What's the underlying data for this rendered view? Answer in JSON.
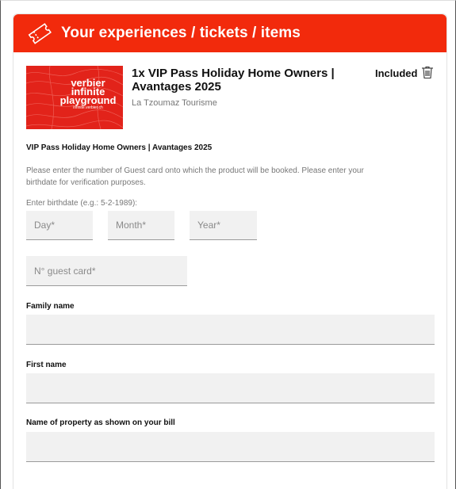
{
  "header": {
    "title": "Your experiences / tickets / items",
    "icon": "ticket-icon",
    "color": "#f22a0c"
  },
  "product": {
    "image_text": {
      "line1": "verbier",
      "line2": "infinite",
      "line3": "playground",
      "line4": "infinite.verbier.ch"
    },
    "title": "1x VIP Pass Holiday Home Owners | Avantages 2025",
    "vendor": "La Tzoumaz Tourisme",
    "status": "Included",
    "delete_icon": "trash-icon"
  },
  "form": {
    "section_title": "VIP Pass Holiday Home Owners | Avantages 2025",
    "help_text": "Please enter the number of Guest card onto which the product will be booked. Please enter your birthdate for verification purposes.",
    "birthdate_label": "Enter birthdate (e.g.: 5-2-1989):",
    "day_placeholder": "Day*",
    "month_placeholder": "Month*",
    "year_placeholder": "Year*",
    "guest_card_placeholder": "N° guest card*",
    "family_name_label": "Family name",
    "first_name_label": "First name",
    "property_label": "Name of property as shown on your bill"
  }
}
